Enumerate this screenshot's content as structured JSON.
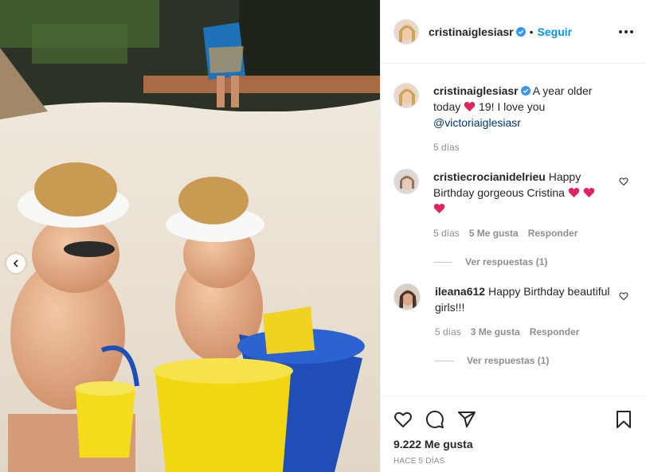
{
  "post": {
    "username": "cristinaiglesiasr",
    "follow_label": "Seguir",
    "dot": "•",
    "caption": {
      "username": "cristinaiglesiasr",
      "text_before": "A year older today",
      "text_after": "19! I love you",
      "mention": "@victoriaiglesiasr",
      "time": "5 días"
    },
    "comments": [
      {
        "username": "cristiecrocianidelrieu",
        "text": "Happy Birthday gorgeous Cristina",
        "time": "5 días",
        "likes": "5 Me gusta",
        "reply": "Responder",
        "view_replies": "Ver respuestas (1)"
      },
      {
        "username": "ileana612",
        "text": "Happy Birthday beautiful girls!!!",
        "time": "5 días",
        "likes": "3 Me gusta",
        "reply": "Responder",
        "view_replies": "Ver respuestas (1)"
      }
    ],
    "like_count": "9.222 Me gusta",
    "posted_ago": "HACE 5 DÍAS"
  },
  "colors": {
    "follow": "#0095f6",
    "verified": "#3897f0",
    "heart_emoji": "#e0245e",
    "muted": "#8e8e8e"
  },
  "icons": [
    "verified-badge-icon",
    "more-options-icon",
    "heart-icon",
    "comment-icon",
    "share-icon",
    "bookmark-icon",
    "chevron-left-icon"
  ]
}
